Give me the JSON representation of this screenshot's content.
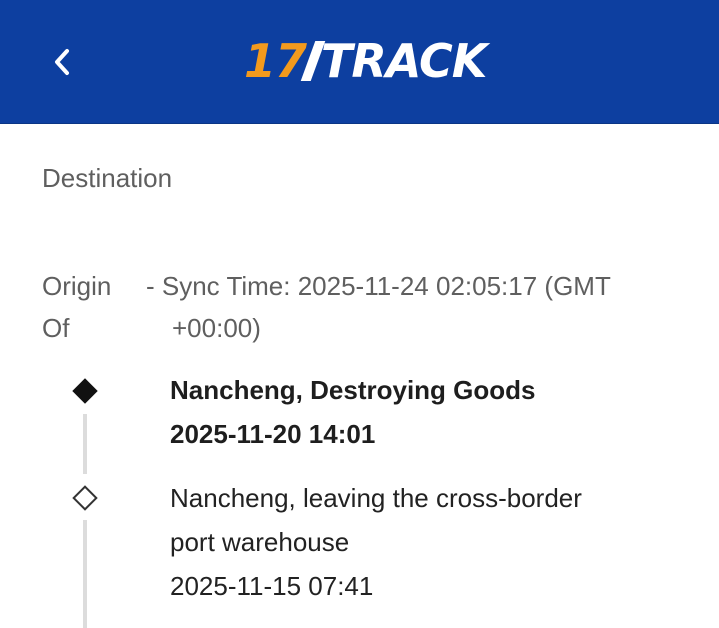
{
  "header": {
    "back_label": "‹",
    "logo_number": "17",
    "logo_text": "TRACK",
    "colors": {
      "background": "#0d3fa0",
      "logo_accent": "#f39a1d"
    }
  },
  "destination_label": "Destination",
  "origin": {
    "label_line1": "Origin",
    "label_line2": "Of",
    "sync_line1": "- Sync Time: 2025-11-24 02:05:17 (GMT",
    "sync_line2": "+00:00)"
  },
  "events": [
    {
      "location_status": "Nancheng, Destroying Goods",
      "datetime": "2025-11-20 14:01",
      "latest": true,
      "marker": "filled-diamond-icon"
    },
    {
      "location_status_line1": "Nancheng, leaving the cross-border",
      "location_status_line2": "port warehouse",
      "datetime": "2025-11-15 07:41",
      "latest": false,
      "marker": "hollow-diamond-icon"
    }
  ]
}
